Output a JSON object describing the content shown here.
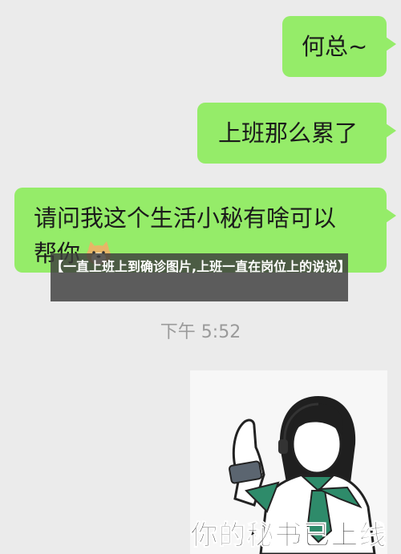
{
  "messages": [
    {
      "text": "何总~"
    },
    {
      "text": "上班那么累了"
    },
    {
      "line1": "请问我这个生活小秘有啥可以",
      "line2": "帮你"
    }
  ],
  "caption": "【一直上班上到确诊图片,上班一直在岗位上的说说】",
  "timestamp": "下午 5:52",
  "sticker": {
    "text": "你的秘书已上线",
    "icon": "doge-emoji"
  },
  "colors": {
    "bubble": "#95ec69",
    "background": "#ebebeb"
  }
}
